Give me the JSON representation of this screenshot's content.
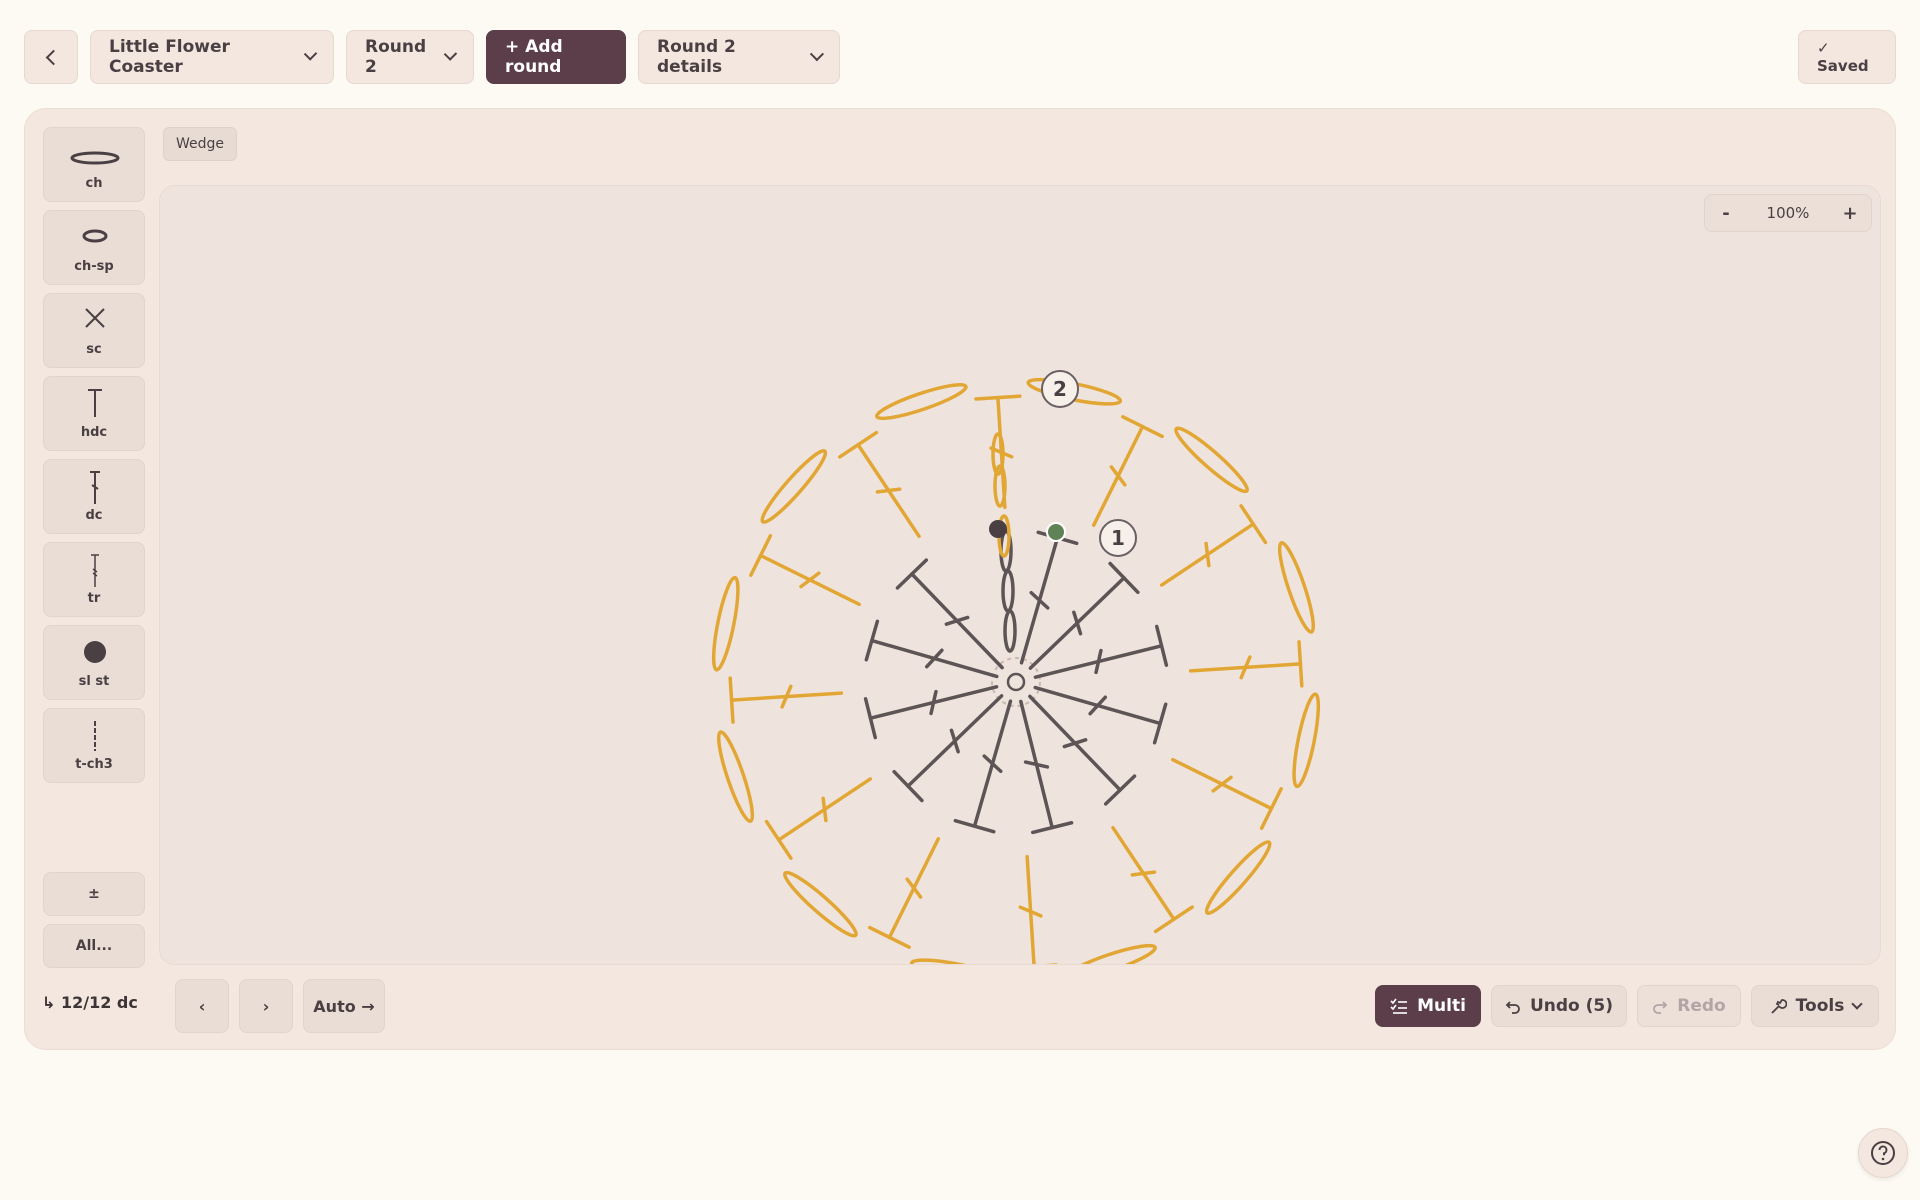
{
  "header": {
    "pattern_name": "Little Flower Coaster",
    "round_select": "Round 2",
    "add_round_label": "+ Add round",
    "round_details_label": "Round 2 details",
    "saved_label": "✓ Saved"
  },
  "palette": {
    "tools": [
      {
        "symbol": "ch",
        "label": "ch"
      },
      {
        "symbol": "ch-sp",
        "label": "ch-sp"
      },
      {
        "symbol": "sc",
        "label": "sc"
      },
      {
        "symbol": "hdc",
        "label": "hdc"
      },
      {
        "symbol": "dc",
        "label": "dc"
      },
      {
        "symbol": "tr",
        "label": "tr"
      },
      {
        "symbol": "sl-st",
        "label": "sl st"
      },
      {
        "symbol": "t-ch3",
        "label": "t-ch3"
      }
    ],
    "toggle_label": "±",
    "all_label": "All..."
  },
  "canvas": {
    "tag_label": "Wedge",
    "zoom": {
      "minus": "-",
      "value": "100%",
      "plus": "+"
    },
    "round_markers": [
      "1",
      "2"
    ]
  },
  "footer": {
    "stitch_count": "↳ 12/12 dc",
    "prev_label": "‹",
    "next_label": "›",
    "auto_label": "Auto →",
    "multi_label": "Multi",
    "undo_label": "Undo (5)",
    "redo_label": "Redo",
    "tools_label": "Tools"
  },
  "colors": {
    "accent": "#5b3e4a",
    "round1": "#5d5456",
    "round2": "#e2a634",
    "marker_green": "#5f8256",
    "background": "#fdf9f3",
    "panel": "#f3e7e0"
  }
}
